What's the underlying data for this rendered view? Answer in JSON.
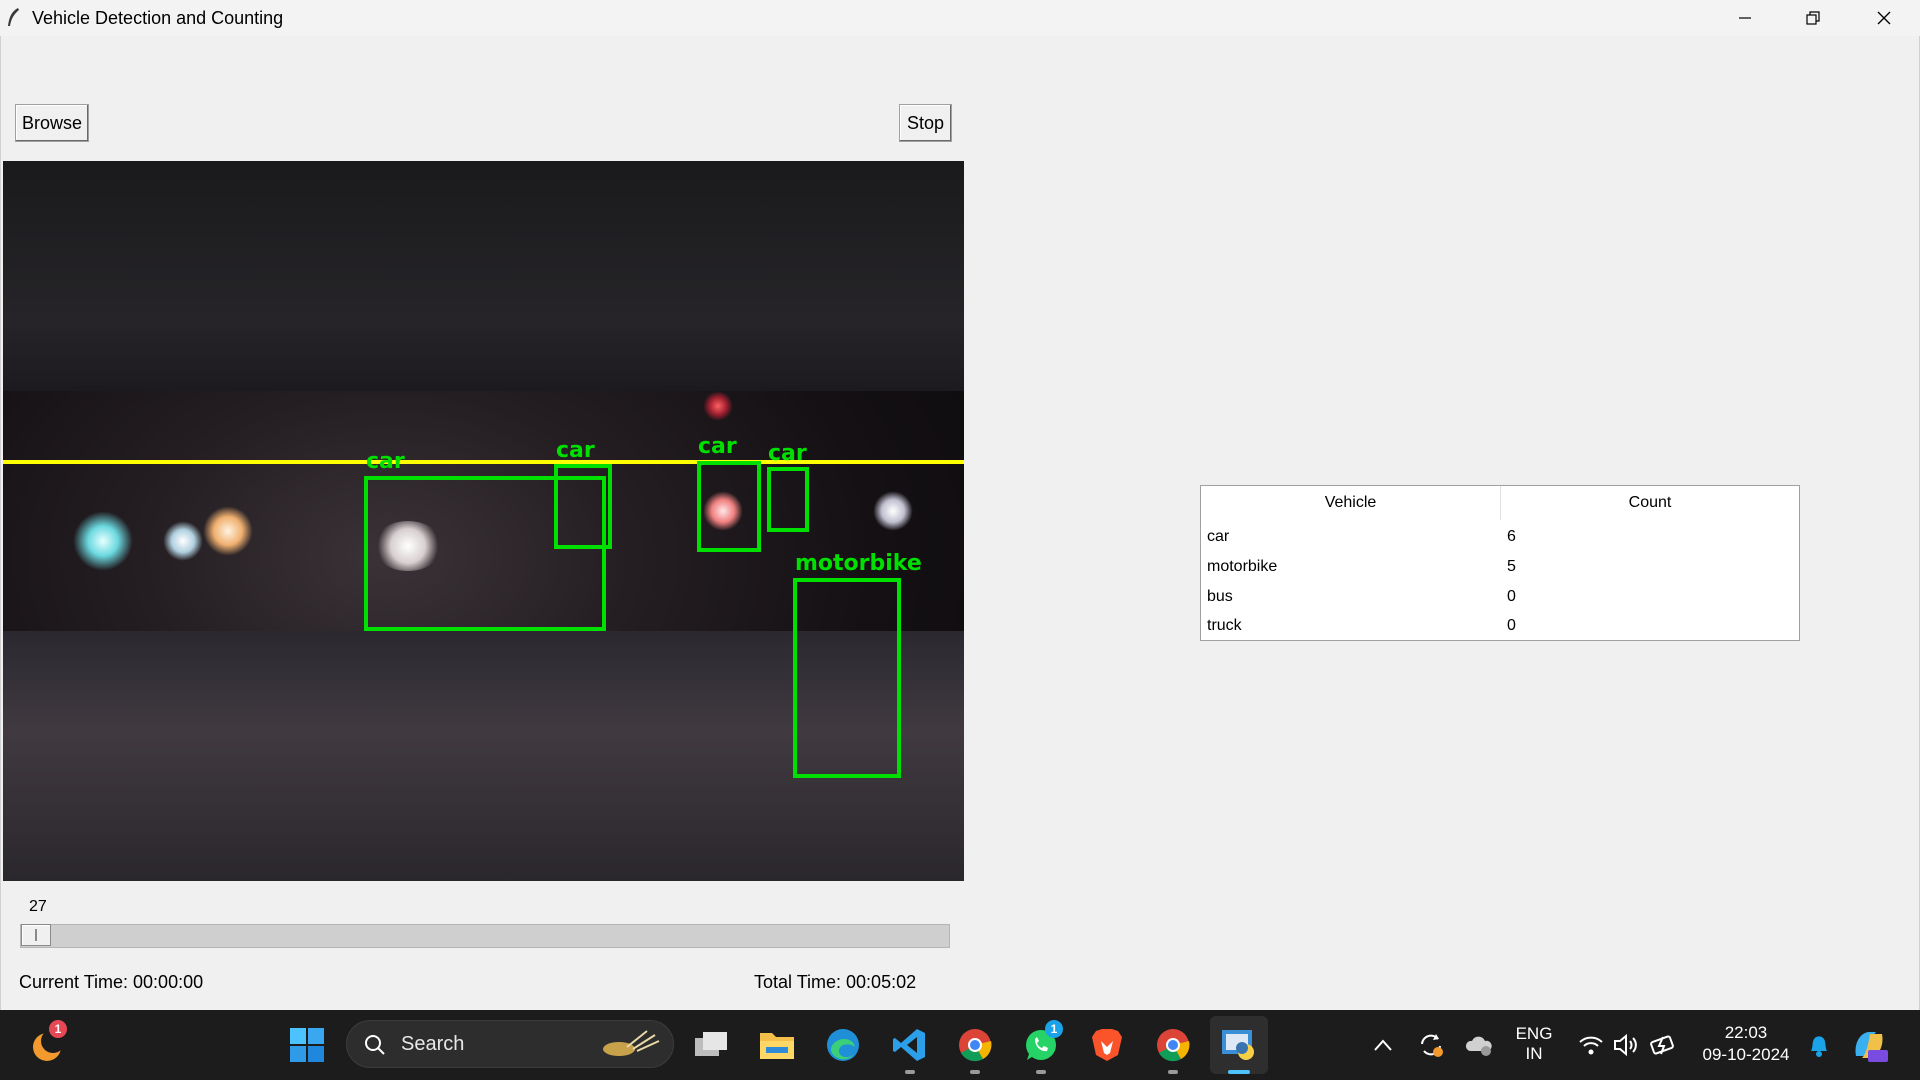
{
  "window": {
    "title": "Vehicle Detection and Counting"
  },
  "toolbar": {
    "browse_label": "Browse",
    "stop_label": "Stop"
  },
  "video": {
    "detections": [
      {
        "label": "car"
      },
      {
        "label": "car"
      },
      {
        "label": "car"
      },
      {
        "label": "car"
      },
      {
        "label": "motorbike"
      }
    ],
    "count_line_color": "#ffff00",
    "box_color": "#00e000"
  },
  "slider": {
    "value": "27"
  },
  "times": {
    "current": "Current Time: 00:00:00",
    "total": "Total Time: 00:05:02"
  },
  "table": {
    "headers": [
      "Vehicle",
      "Count"
    ],
    "rows": [
      {
        "vehicle": "car",
        "count": "6"
      },
      {
        "vehicle": "motorbike",
        "count": "5"
      },
      {
        "vehicle": "bus",
        "count": "0"
      },
      {
        "vehicle": "truck",
        "count": "0"
      }
    ]
  },
  "taskbar": {
    "search_label": "Search",
    "language": {
      "line1": "ENG",
      "line2": "IN"
    },
    "clock": {
      "time": "22:03",
      "date": "09-10-2024"
    },
    "badges": {
      "start_app": "1",
      "whatsapp": "1"
    }
  }
}
